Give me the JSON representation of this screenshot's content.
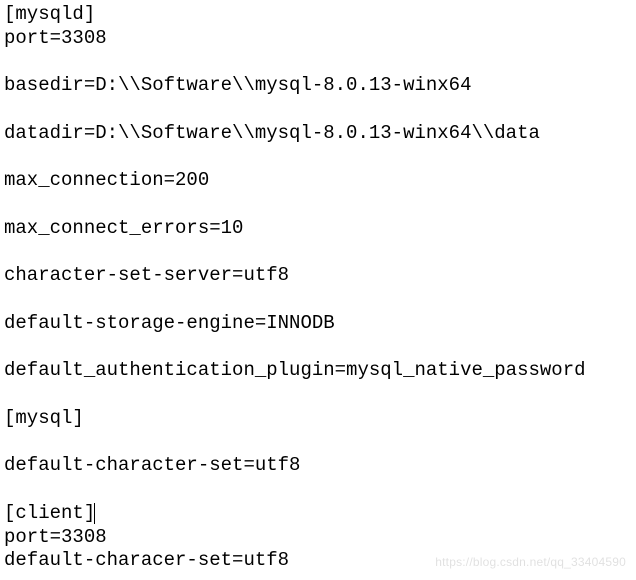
{
  "config": {
    "lines": [
      "[mysqld]",
      "port=3308",
      "",
      "basedir=D:\\\\Software\\\\mysql-8.0.13-winx64",
      "",
      "datadir=D:\\\\Software\\\\mysql-8.0.13-winx64\\\\data",
      "",
      "max_connection=200",
      "",
      "max_connect_errors=10",
      "",
      "character-set-server=utf8",
      "",
      "default-storage-engine=INNODB",
      "",
      "default_authentication_plugin=mysql_native_password",
      "",
      "[mysql]",
      "",
      "default-character-set=utf8",
      "",
      "[client]",
      "port=3308",
      "default-characer-set=utf8"
    ],
    "cursor_line": 21
  },
  "watermark": "https://blog.csdn.net/qq_33404590"
}
